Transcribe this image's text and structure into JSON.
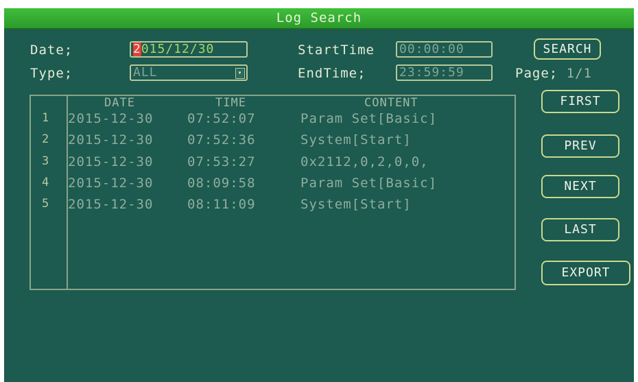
{
  "window": {
    "title": "Log Search"
  },
  "form": {
    "date_label": "Date;",
    "date_cursor": "2",
    "date_rest": "015/12/30",
    "type_label": "Type;",
    "type_value": "ALL",
    "start_label": "StartTime",
    "start_value": "00:00:00",
    "end_label": "EndTime;",
    "end_value": "23:59:59",
    "page_label": "Page;",
    "page_value": "1/1"
  },
  "buttons": {
    "search": "SEARCH",
    "first": "FIRST",
    "prev": "PREV",
    "next": "NEXT",
    "last": "LAST",
    "export": "EXPORT"
  },
  "table": {
    "headers": [
      "DATE",
      "TIME",
      "CONTENT"
    ],
    "rows": [
      {
        "num": "1",
        "date": "2015-12-30",
        "time": "07:52:07",
        "content": "Param Set[Basic]"
      },
      {
        "num": "2",
        "date": "2015-12-30",
        "time": "07:52:36",
        "content": "System[Start]"
      },
      {
        "num": "3",
        "date": "2015-12-30",
        "time": "07:53:27",
        "content": "0x2112,0,2,0,0,"
      },
      {
        "num": "4",
        "date": "2015-12-30",
        "time": "08:09:58",
        "content": "Param Set[Basic]"
      },
      {
        "num": "5",
        "date": "2015-12-30",
        "time": "08:11:09",
        "content": "System[Start]"
      }
    ]
  },
  "icons": {
    "combo": "dropdown-arrow-icon"
  },
  "colors": {
    "background": "#1d5a4f",
    "titlebar": "#2c9a2b",
    "cursor": "#e2403a"
  }
}
